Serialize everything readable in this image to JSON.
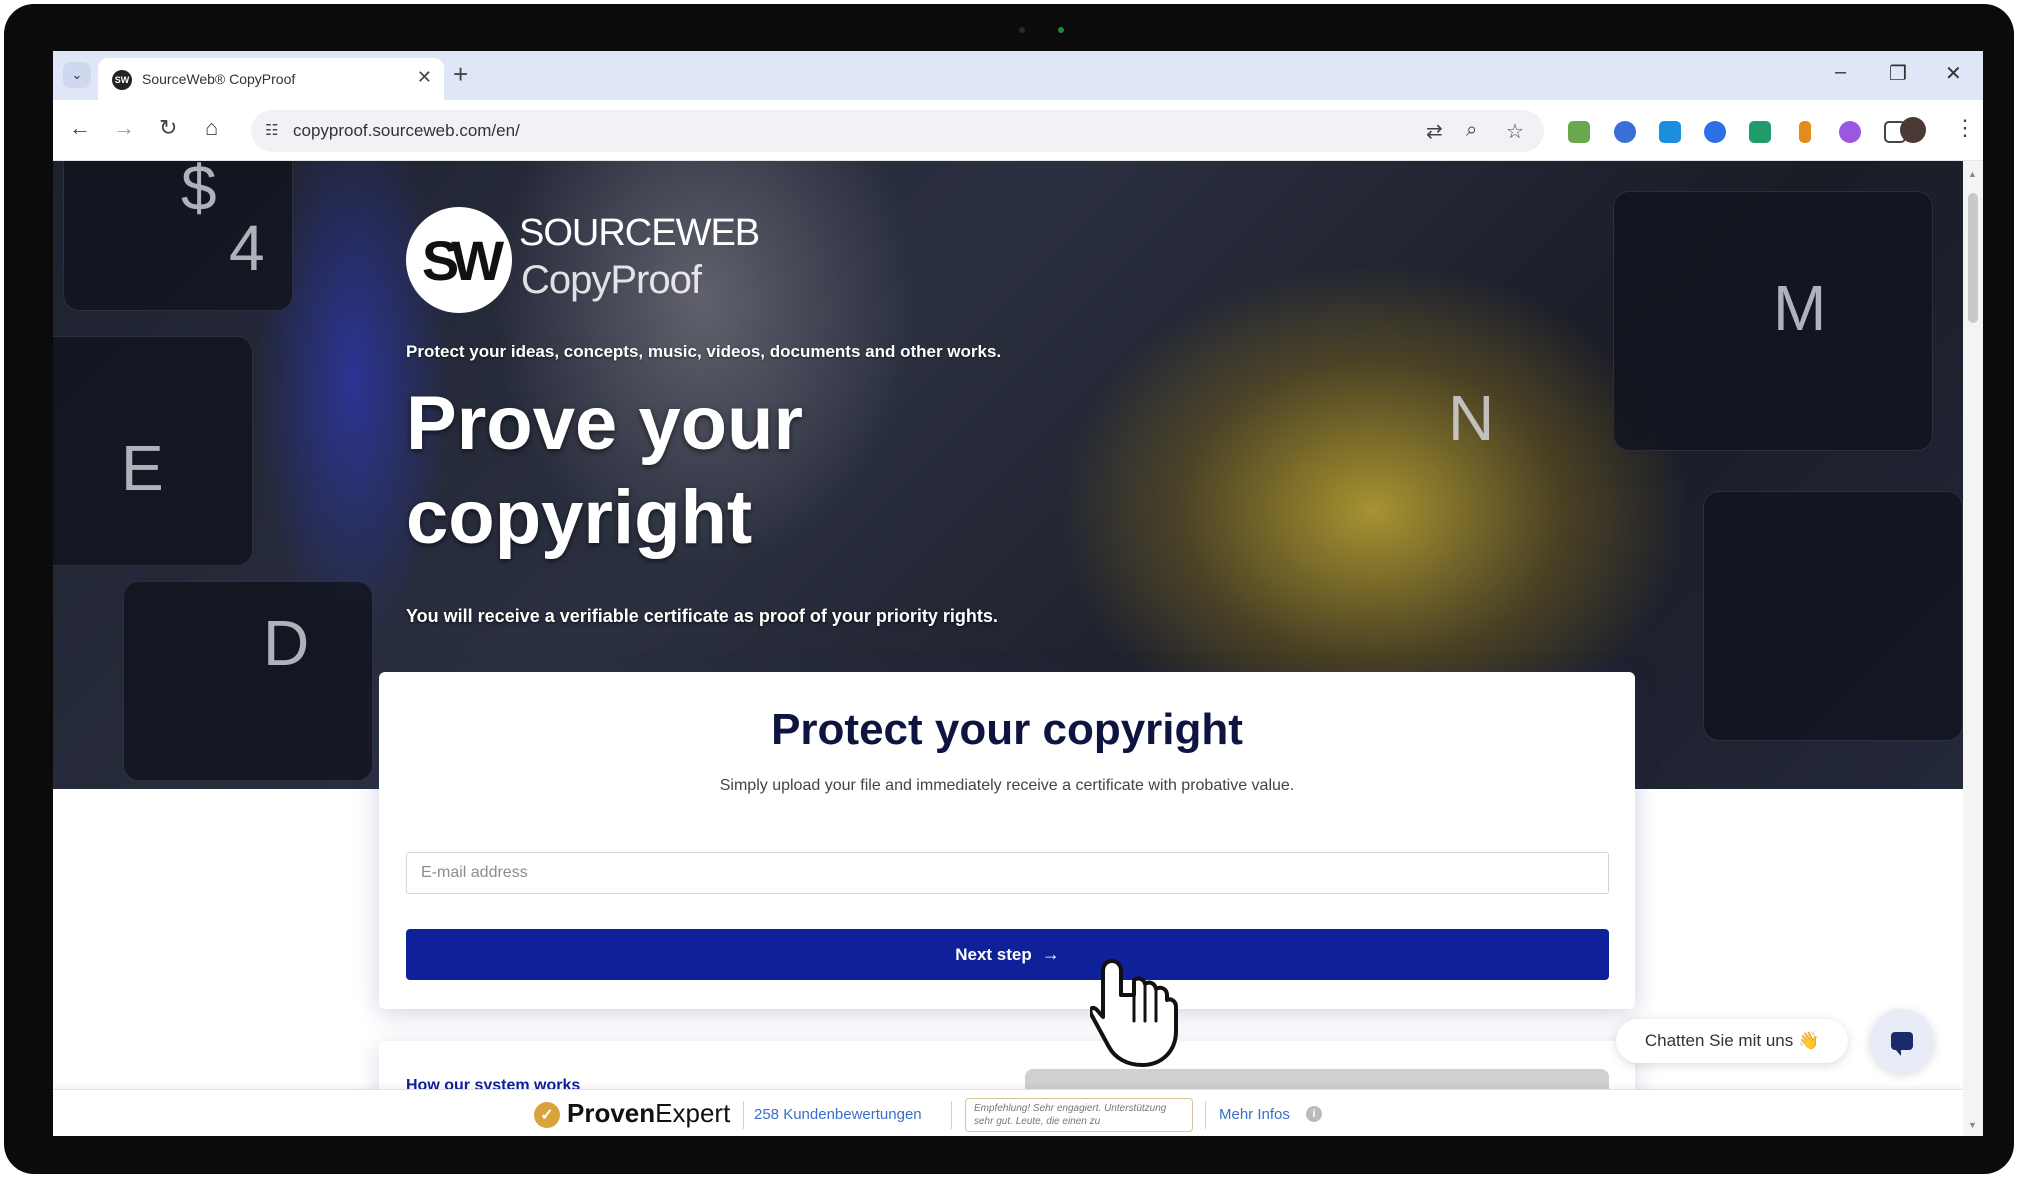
{
  "browser": {
    "tab_title": "SourceWeb® CopyProof",
    "favicon_text": "SW",
    "url": "copyproof.sourceweb.com/en/"
  },
  "hero": {
    "logo_mark": "SW",
    "logo_name": "SOURCEWEB",
    "logo_product": "CopyProof",
    "tagline": "Protect your ideas, concepts, music, videos, documents and other works.",
    "title": "Prove your copyright",
    "subtitle": "You will receive a verifiable certificate as proof of your priority rights.",
    "key_letters": [
      "$",
      "4",
      "E",
      "D",
      "M",
      "N"
    ]
  },
  "card": {
    "title": "Protect your copyright",
    "subtitle": "Simply upload your file and immediately receive a certificate with probative value.",
    "email_placeholder": "E-mail address",
    "next_label": "Next step",
    "next_arrow": "→"
  },
  "card2": {
    "link_text": "How our system works"
  },
  "chat": {
    "label": "Chatten Sie mit uns 👋"
  },
  "proven_expert": {
    "brand_bold": "Proven",
    "brand_rest": "Expert",
    "reviews": "258 Kundenbewertungen",
    "quote": "Empfehlung! Sehr engagiert. Unterstützung sehr gut. Leute, die einen zu",
    "more_info": "Mehr Infos",
    "info_glyph": "i",
    "check_glyph": "✓"
  },
  "colors": {
    "primary": "#0f2199",
    "title_navy": "#0d1440",
    "tabstrip": "#dfe6f7",
    "pe_gold": "#d8a33b"
  }
}
